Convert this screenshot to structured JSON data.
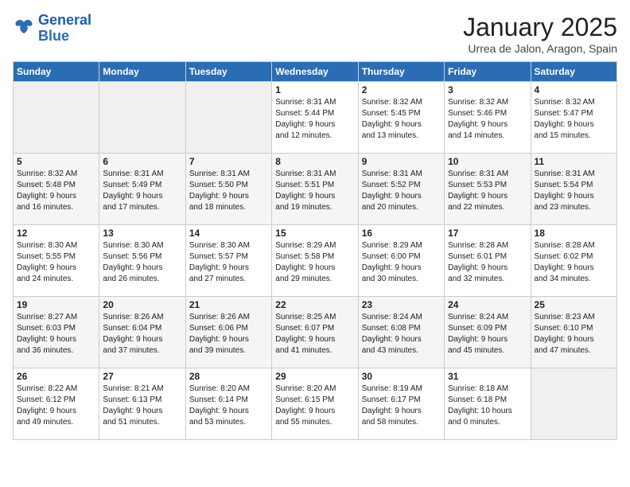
{
  "header": {
    "logo_line1": "General",
    "logo_line2": "Blue",
    "month": "January 2025",
    "location": "Urrea de Jalon, Aragon, Spain"
  },
  "weekdays": [
    "Sunday",
    "Monday",
    "Tuesday",
    "Wednesday",
    "Thursday",
    "Friday",
    "Saturday"
  ],
  "weeks": [
    [
      {
        "day": "",
        "text": ""
      },
      {
        "day": "",
        "text": ""
      },
      {
        "day": "",
        "text": ""
      },
      {
        "day": "1",
        "text": "Sunrise: 8:31 AM\nSunset: 5:44 PM\nDaylight: 9 hours\nand 12 minutes."
      },
      {
        "day": "2",
        "text": "Sunrise: 8:32 AM\nSunset: 5:45 PM\nDaylight: 9 hours\nand 13 minutes."
      },
      {
        "day": "3",
        "text": "Sunrise: 8:32 AM\nSunset: 5:46 PM\nDaylight: 9 hours\nand 14 minutes."
      },
      {
        "day": "4",
        "text": "Sunrise: 8:32 AM\nSunset: 5:47 PM\nDaylight: 9 hours\nand 15 minutes."
      }
    ],
    [
      {
        "day": "5",
        "text": "Sunrise: 8:32 AM\nSunset: 5:48 PM\nDaylight: 9 hours\nand 16 minutes."
      },
      {
        "day": "6",
        "text": "Sunrise: 8:31 AM\nSunset: 5:49 PM\nDaylight: 9 hours\nand 17 minutes."
      },
      {
        "day": "7",
        "text": "Sunrise: 8:31 AM\nSunset: 5:50 PM\nDaylight: 9 hours\nand 18 minutes."
      },
      {
        "day": "8",
        "text": "Sunrise: 8:31 AM\nSunset: 5:51 PM\nDaylight: 9 hours\nand 19 minutes."
      },
      {
        "day": "9",
        "text": "Sunrise: 8:31 AM\nSunset: 5:52 PM\nDaylight: 9 hours\nand 20 minutes."
      },
      {
        "day": "10",
        "text": "Sunrise: 8:31 AM\nSunset: 5:53 PM\nDaylight: 9 hours\nand 22 minutes."
      },
      {
        "day": "11",
        "text": "Sunrise: 8:31 AM\nSunset: 5:54 PM\nDaylight: 9 hours\nand 23 minutes."
      }
    ],
    [
      {
        "day": "12",
        "text": "Sunrise: 8:30 AM\nSunset: 5:55 PM\nDaylight: 9 hours\nand 24 minutes."
      },
      {
        "day": "13",
        "text": "Sunrise: 8:30 AM\nSunset: 5:56 PM\nDaylight: 9 hours\nand 26 minutes."
      },
      {
        "day": "14",
        "text": "Sunrise: 8:30 AM\nSunset: 5:57 PM\nDaylight: 9 hours\nand 27 minutes."
      },
      {
        "day": "15",
        "text": "Sunrise: 8:29 AM\nSunset: 5:58 PM\nDaylight: 9 hours\nand 29 minutes."
      },
      {
        "day": "16",
        "text": "Sunrise: 8:29 AM\nSunset: 6:00 PM\nDaylight: 9 hours\nand 30 minutes."
      },
      {
        "day": "17",
        "text": "Sunrise: 8:28 AM\nSunset: 6:01 PM\nDaylight: 9 hours\nand 32 minutes."
      },
      {
        "day": "18",
        "text": "Sunrise: 8:28 AM\nSunset: 6:02 PM\nDaylight: 9 hours\nand 34 minutes."
      }
    ],
    [
      {
        "day": "19",
        "text": "Sunrise: 8:27 AM\nSunset: 6:03 PM\nDaylight: 9 hours\nand 36 minutes."
      },
      {
        "day": "20",
        "text": "Sunrise: 8:26 AM\nSunset: 6:04 PM\nDaylight: 9 hours\nand 37 minutes."
      },
      {
        "day": "21",
        "text": "Sunrise: 8:26 AM\nSunset: 6:06 PM\nDaylight: 9 hours\nand 39 minutes."
      },
      {
        "day": "22",
        "text": "Sunrise: 8:25 AM\nSunset: 6:07 PM\nDaylight: 9 hours\nand 41 minutes."
      },
      {
        "day": "23",
        "text": "Sunrise: 8:24 AM\nSunset: 6:08 PM\nDaylight: 9 hours\nand 43 minutes."
      },
      {
        "day": "24",
        "text": "Sunrise: 8:24 AM\nSunset: 6:09 PM\nDaylight: 9 hours\nand 45 minutes."
      },
      {
        "day": "25",
        "text": "Sunrise: 8:23 AM\nSunset: 6:10 PM\nDaylight: 9 hours\nand 47 minutes."
      }
    ],
    [
      {
        "day": "26",
        "text": "Sunrise: 8:22 AM\nSunset: 6:12 PM\nDaylight: 9 hours\nand 49 minutes."
      },
      {
        "day": "27",
        "text": "Sunrise: 8:21 AM\nSunset: 6:13 PM\nDaylight: 9 hours\nand 51 minutes."
      },
      {
        "day": "28",
        "text": "Sunrise: 8:20 AM\nSunset: 6:14 PM\nDaylight: 9 hours\nand 53 minutes."
      },
      {
        "day": "29",
        "text": "Sunrise: 8:20 AM\nSunset: 6:15 PM\nDaylight: 9 hours\nand 55 minutes."
      },
      {
        "day": "30",
        "text": "Sunrise: 8:19 AM\nSunset: 6:17 PM\nDaylight: 9 hours\nand 58 minutes."
      },
      {
        "day": "31",
        "text": "Sunrise: 8:18 AM\nSunset: 6:18 PM\nDaylight: 10 hours\nand 0 minutes."
      },
      {
        "day": "",
        "text": ""
      }
    ]
  ]
}
